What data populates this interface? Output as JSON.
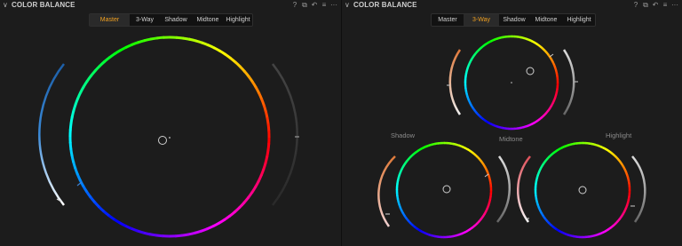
{
  "left_panel": {
    "title": "COLOR BALANCE",
    "tabs": [
      {
        "label": "Master",
        "active": true
      },
      {
        "label": "3-Way",
        "active": false
      },
      {
        "label": "Shadow",
        "active": false
      },
      {
        "label": "Midtone",
        "active": false
      },
      {
        "label": "Highlight",
        "active": false
      }
    ]
  },
  "right_panel": {
    "title": "COLOR BALANCE",
    "tabs": [
      {
        "label": "Master",
        "active": false
      },
      {
        "label": "3-Way",
        "active": true
      },
      {
        "label": "Shadow",
        "active": false
      },
      {
        "label": "Midtone",
        "active": false
      },
      {
        "label": "Highlight",
        "active": false
      }
    ],
    "wheel_labels": {
      "shadow": "Shadow",
      "midtone": "Midtone",
      "highlight": "Highlight"
    }
  },
  "header_icons": [
    "help-icon",
    "pin-icon",
    "reset-icon",
    "menu-icon",
    "more-icon"
  ],
  "colors": {
    "active_tab": "#f0a020",
    "background": "#1c1c1c"
  }
}
